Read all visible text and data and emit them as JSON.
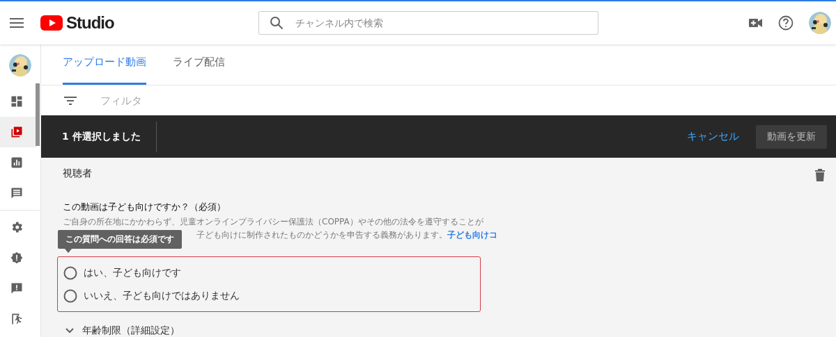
{
  "header": {
    "logo_text": "Studio",
    "search": {
      "placeholder": "チャンネル内で検索"
    }
  },
  "sidebar": {
    "items": [
      {
        "selected": false
      },
      {
        "selected": true
      },
      {
        "selected": false
      },
      {
        "selected": false
      },
      {
        "selected": false
      },
      {
        "selected": false
      },
      {
        "selected": false
      },
      {
        "selected": false
      }
    ]
  },
  "tabs": [
    {
      "label": "アップロード動画",
      "selected": true
    },
    {
      "label": "ライブ配信",
      "selected": false
    }
  ],
  "filter": {
    "placeholder": "フィルタ"
  },
  "selection_bar": {
    "count_text": "1 件選択しました",
    "cancel": "キャンセル",
    "update": {
      "label": "動画を更新",
      "disabled": true
    }
  },
  "panel": {
    "title": "視聴者",
    "question": "この動画は子ども向けですか？（必須）",
    "description_line_1": "ご自身の所在地にかかわらず、児童オンラインプライバシー保護法（COPPA）やその他の法令を遵守することが",
    "description_line_2": "子ども向けに制作されたものかどうかを申告する義務があります。",
    "link": "子ども向けコ",
    "tooltip": "この質問への回答は必須です",
    "error": true,
    "options": [
      {
        "label": "はい、子ども向けです",
        "selected": false
      },
      {
        "label": "いいえ、子ども向けではありません",
        "selected": false
      }
    ],
    "age_restriction": {
      "label": "年齢制限（詳細設定）",
      "expanded": false
    }
  }
}
